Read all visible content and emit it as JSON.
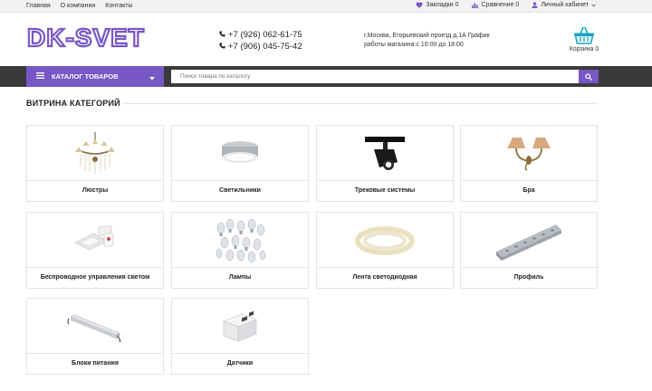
{
  "topbar": {
    "nav": [
      "Главная",
      "О компании",
      "Контакты"
    ],
    "bookmarks": "Закладки 0",
    "compare": "Сравнение 0",
    "account": "Личный кабинет"
  },
  "header": {
    "logo": "DK-SVET",
    "phones": [
      "+7 (926) 062-61-75",
      "+7 (906) 045-75-42"
    ],
    "address_line1": "г.Москва, Егорьевский проезд д.1А График",
    "address_line2": "работы магазина:с 10:00 до 18:00",
    "cart": "Корзина 0"
  },
  "navbar": {
    "catalog": "КАТАЛОГ ТОВАРОВ",
    "search_placeholder": "Поиск товара по каталогу"
  },
  "section_title": "ВИТРИНА КАТЕГОРИЙ",
  "categories": [
    {
      "label": "Люстры",
      "icon": "chandelier-image"
    },
    {
      "label": "Светильники",
      "icon": "ceiling-light-image"
    },
    {
      "label": "Трековые системы",
      "icon": "track-light-image"
    },
    {
      "label": "Бра",
      "icon": "sconce-image"
    },
    {
      "label": "Беспроводное управления светом",
      "icon": "wireless-switch-image"
    },
    {
      "label": "Лампы",
      "icon": "lamps-image"
    },
    {
      "label": "Лента светодиодная",
      "icon": "led-strip-image"
    },
    {
      "label": "Профиль",
      "icon": "profile-image"
    },
    {
      "label": "Блоки питания",
      "icon": "power-supply-image"
    },
    {
      "label": "Датчики",
      "icon": "sensor-image"
    }
  ],
  "colors": {
    "accent": "#7758c5",
    "navbar": "#3a3a3d",
    "topbar": "#f2f2f2"
  }
}
